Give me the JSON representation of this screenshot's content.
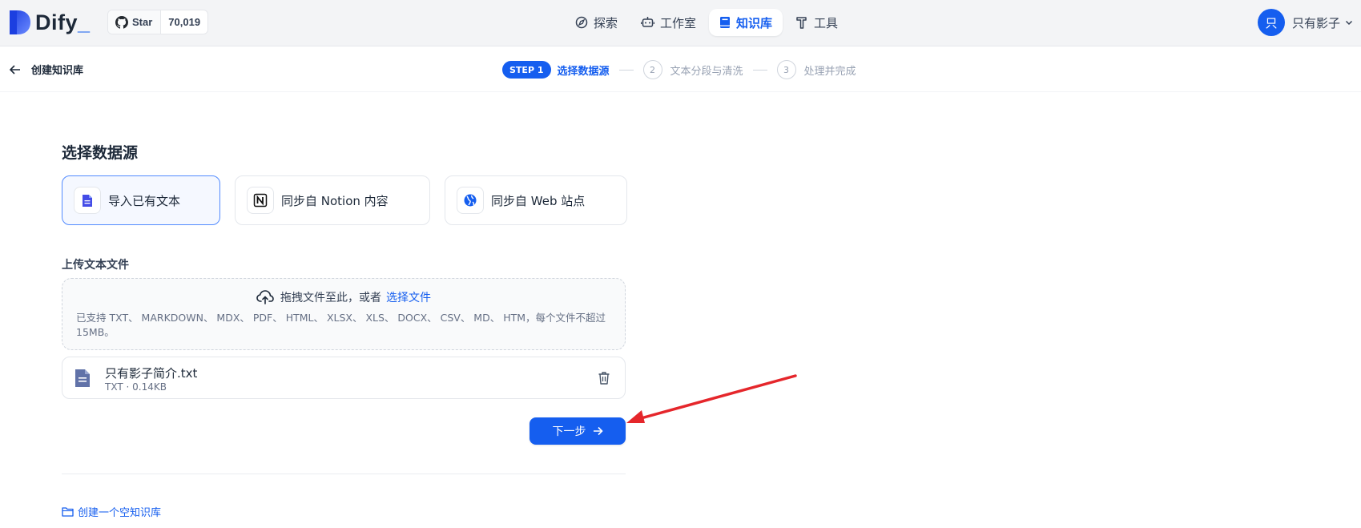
{
  "header": {
    "logo_text": "Dify",
    "logo_suffix": "_",
    "github": {
      "star_label": "Star",
      "count": "70,019"
    },
    "nav": [
      {
        "label": "探索",
        "icon": "compass-icon",
        "active": false
      },
      {
        "label": "工作室",
        "icon": "robot-icon",
        "active": false
      },
      {
        "label": "知识库",
        "icon": "book-icon",
        "active": true
      },
      {
        "label": "工具",
        "icon": "hammer-icon",
        "active": false
      }
    ],
    "user": {
      "avatar_initial": "只",
      "name": "只有影子"
    }
  },
  "subheader": {
    "back_title": "创建知识库",
    "steps": [
      {
        "badge": "STEP 1",
        "label": "选择数据源",
        "active": true
      },
      {
        "number": "2",
        "label": "文本分段与清洗",
        "active": false
      },
      {
        "number": "3",
        "label": "处理并完成",
        "active": false
      }
    ]
  },
  "main": {
    "section_title": "选择数据源",
    "sources": [
      {
        "label": "导入已有文本",
        "icon": "document-icon",
        "active": true
      },
      {
        "label": "同步自 Notion 内容",
        "icon": "notion-icon",
        "active": false
      },
      {
        "label": "同步自 Web 站点",
        "icon": "globe-icon",
        "active": false
      }
    ],
    "upload_label": "上传文本文件",
    "dropzone": {
      "text": "拖拽文件至此，或者",
      "link": "选择文件",
      "note": "已支持 TXT、 MARKDOWN、 MDX、 PDF、 HTML、 XLSX、 XLS、 DOCX、 CSV、 MD、 HTM，每个文件不超过 15MB。"
    },
    "file": {
      "name": "只有影子简介.txt",
      "meta": "TXT · 0.14KB"
    },
    "next_button": "下一步",
    "empty_kb_link": "创建一个空知识库"
  },
  "colors": {
    "primary": "#155eef",
    "annotation_arrow": "#e5262b",
    "header_bg": "#f3f4f6"
  }
}
